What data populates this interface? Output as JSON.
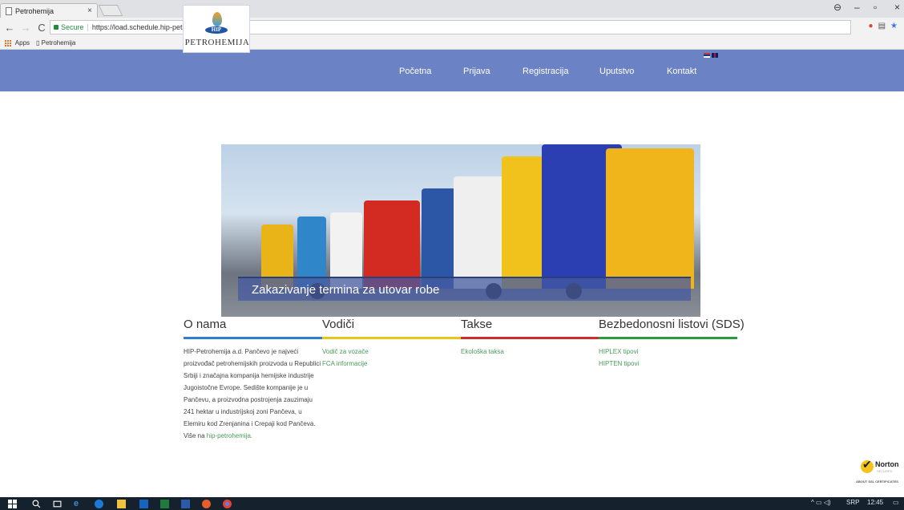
{
  "browser": {
    "tab_title": "Petrohemija",
    "tab_close": "×",
    "secure_label": "Secure",
    "url": "https://load.schedule.hip-petrohemija.com",
    "bookmarks": {
      "apps": "Apps",
      "petrohemija": "Petrohemija"
    },
    "nav": {
      "back": "←",
      "forward": "→",
      "reload": "C"
    }
  },
  "site": {
    "logo_text": "PETROHEMIJA",
    "logo_badge": "HIP",
    "nav": [
      "Početna",
      "Prijava",
      "Registracija",
      "Uputstvo",
      "Kontakt"
    ],
    "hero_caption": "Zakazivanje termina za utovar robe",
    "sections": {
      "about": {
        "title": "O nama",
        "text": "HIP-Petrohemija a.d. Pančevo je najveći proizvođač petrohemijskih proizvoda u Republici Srbiji i značajna kompanija hemijske industrije Jugoistočne Evrope. Sedište kompanije je u Pančevu, a proizvodna postrojenja zauzimaju 241 hektar u industrijskoj zoni Pančeva, u Elemiru kod Zrenjanina i Crepaji kod Pančeva. Više na",
        "link": "hip-petrohemija."
      },
      "guides": {
        "title": "Vodiči",
        "links": [
          "Vodič za vozače",
          "FCA informacije"
        ]
      },
      "fees": {
        "title": "Takse",
        "links": [
          "Ekološka taksa"
        ]
      },
      "sds": {
        "title": "Bezbedonosni listovi (SDS)",
        "links": [
          "HIPLEX tipovi",
          "HIPTEN tipovi"
        ]
      }
    },
    "norton": {
      "brand": "Norton",
      "sub": "SECURED",
      "about": "ABOUT SSL CERTIFICATES"
    }
  },
  "taskbar": {
    "lang": "SRP",
    "time": "12:45"
  },
  "colors": {
    "header_bg": "#6b82c4",
    "bar_about": "#2f7fd0",
    "bar_guides": "#e6c619",
    "bar_fees": "#d12b2b",
    "bar_sds": "#2d9a3b",
    "link": "#4a9a5a"
  }
}
